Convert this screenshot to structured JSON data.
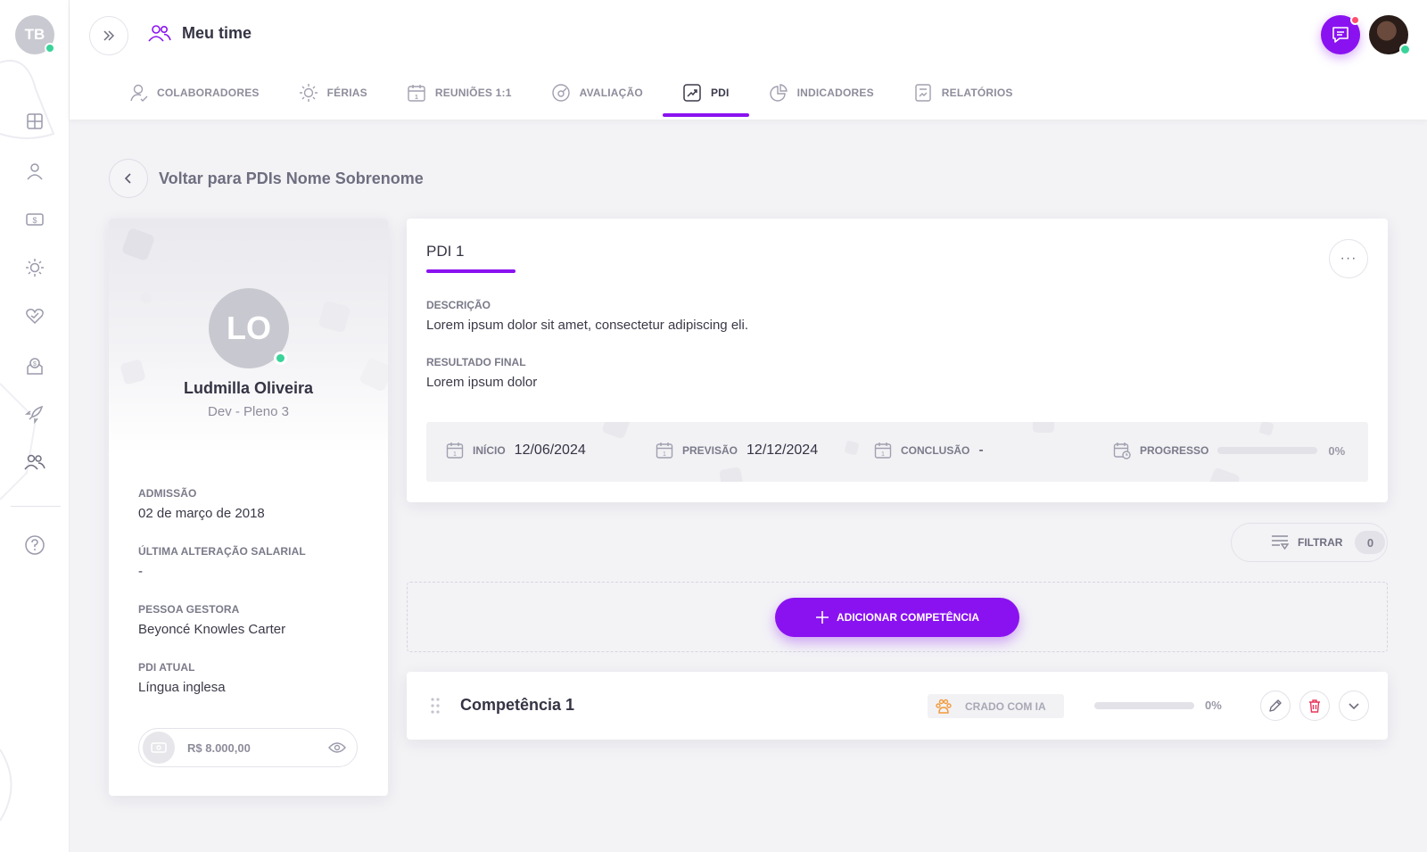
{
  "rail": {
    "avatar_initials": "TB",
    "items": [
      {
        "icon": "dashboard-icon"
      },
      {
        "icon": "user-icon"
      },
      {
        "icon": "money-icon"
      },
      {
        "icon": "sun-icon"
      },
      {
        "icon": "heart-icon"
      },
      {
        "icon": "benefits-icon"
      },
      {
        "icon": "rocket-icon"
      },
      {
        "icon": "team-icon"
      },
      {
        "icon": "help-icon"
      }
    ]
  },
  "header": {
    "title": "Meu time",
    "tabs": [
      {
        "label": "COLABORADORES",
        "icon": "user-check-icon",
        "active": false
      },
      {
        "label": "FÉRIAS",
        "icon": "sun-icon",
        "active": false
      },
      {
        "label": "REUNIÕES 1:1",
        "icon": "calendar-icon",
        "active": false
      },
      {
        "label": "AVALIAÇÃO",
        "icon": "gauge-icon",
        "active": false
      },
      {
        "label": "PDI",
        "icon": "trend-icon",
        "active": true
      },
      {
        "label": "INDICADORES",
        "icon": "pie-chart-icon",
        "active": false
      },
      {
        "label": "RELATÓRIOS",
        "icon": "report-icon",
        "active": false
      }
    ]
  },
  "back": {
    "label": "Voltar para PDIs Nome Sobrenome"
  },
  "profile": {
    "initials": "LO",
    "name": "Ludmilla Oliveira",
    "role": "Dev - Pleno  3",
    "fields": [
      {
        "label": "ADMISSÃO",
        "value": "02 de março de 2018"
      },
      {
        "label": "ÚLTIMA ALTERAÇÃO SALARIAL",
        "value": "-"
      },
      {
        "label": "PESSOA GESTORA",
        "value": "Beyoncé Knowles Carter"
      },
      {
        "label": "PDI ATUAL",
        "value": "Língua inglesa"
      }
    ],
    "salary": "R$ 8.000,00"
  },
  "pdi": {
    "title": "PDI 1",
    "more_label": "···",
    "description_label": "DESCRIÇÃO",
    "description": "Lorem ipsum dolor sit amet, consectetur adipiscing eli.",
    "result_label": "RESULTADO FINAL",
    "result": "Lorem ipsum dolor",
    "start_label": "INÍCIO",
    "start": "12/06/2024",
    "forecast_label": "PREVISÃO",
    "forecast": "12/12/2024",
    "conclusion_label": "CONCLUSÃO",
    "conclusion": "-",
    "progress_label": "PROGRESSO",
    "progress_pct": "0%",
    "progress_value": 0
  },
  "filter": {
    "label": "FILTRAR",
    "count": "0"
  },
  "add_button": {
    "label": "ADICIONAR COMPETÊNCIA"
  },
  "competency": {
    "title": "Competência 1",
    "ai_badge": "CRADO COM IA",
    "progress_pct": "0%",
    "progress_value": 0
  },
  "colors": {
    "accent": "#8a12f0",
    "online": "#3ad39a",
    "alert": "#ff4d6d",
    "danger": "#e8345a"
  }
}
